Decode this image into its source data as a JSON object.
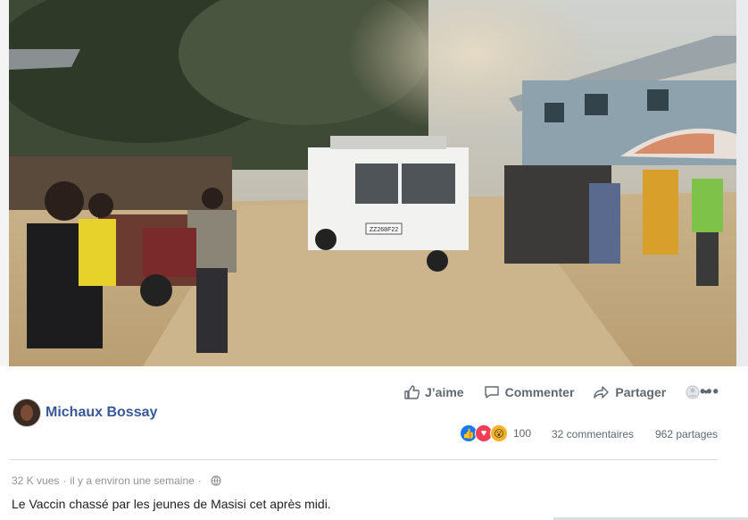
{
  "post": {
    "author": "Michaux Bossay",
    "actions": {
      "like": "J’aime",
      "comment": "Commenter",
      "share": "Partager"
    },
    "stats": {
      "reaction_count": "100",
      "comments": "32 commentaires",
      "shares": "962 partages"
    },
    "meta": {
      "views": "32 K vues",
      "separator": "·",
      "time": "il y a environ une semaine",
      "separator2": "·"
    },
    "caption": "Le Vaccin chassé par les jeunes de Masisi cet après midi.",
    "vehicle_plate": "ZZ268F22",
    "reactions": [
      "like",
      "love",
      "wow"
    ]
  },
  "colors": {
    "author_link": "#385898",
    "like_blue": "#1877f2",
    "love_red": "#f33e58",
    "wow_yellow": "#f7b125",
    "muted_text": "#606770"
  }
}
